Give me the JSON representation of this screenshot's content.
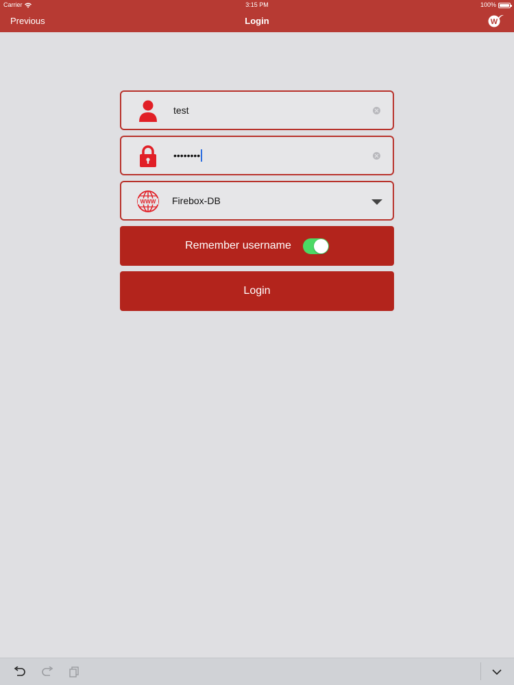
{
  "status_bar": {
    "carrier": "Carrier",
    "time": "3:15 PM",
    "battery": "100%"
  },
  "nav": {
    "back_label": "Previous",
    "title": "Login",
    "logo": "brand-w-logo"
  },
  "form": {
    "username": {
      "icon": "user-icon",
      "value": "test"
    },
    "password": {
      "icon": "lock-icon",
      "masked_value": "••••••••"
    },
    "server": {
      "icon": "globe-www-icon",
      "selected": "Firebox-DB"
    },
    "remember": {
      "label": "Remember username",
      "enabled": true
    },
    "login_button": "Login"
  },
  "colors": {
    "brand": "#b73a33",
    "button": "#b3241c",
    "accent_icon": "#e11f26",
    "toggle_on": "#4cd964"
  },
  "bottom_toolbar": {
    "items": [
      "undo-icon",
      "redo-icon",
      "paste-icon",
      "chevron-down-icon"
    ]
  }
}
